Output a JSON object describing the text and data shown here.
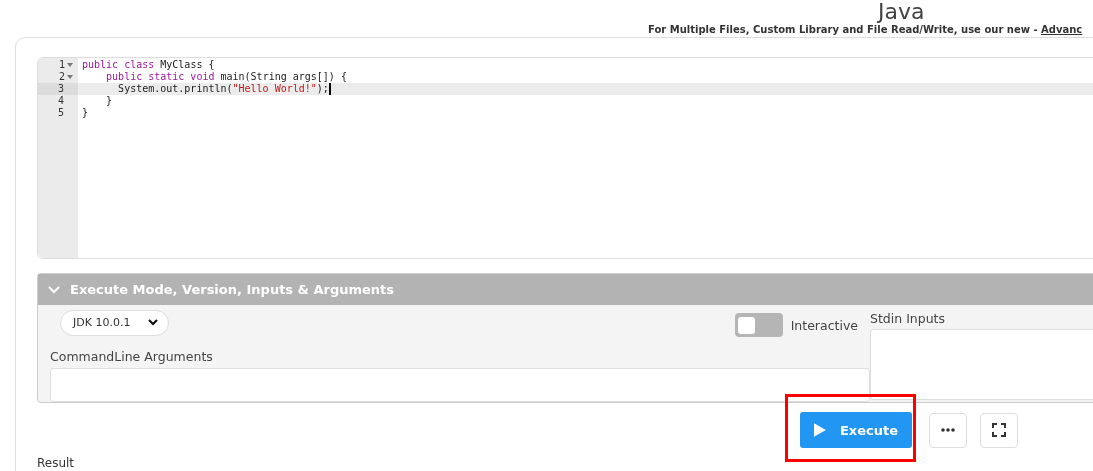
{
  "header": {
    "title": "Java",
    "notice": "For Multiple Files, Custom Library and File Read/Write, use our new - ",
    "notice_link": "Advanc"
  },
  "editor": {
    "lines": [
      {
        "number": "1",
        "foldable": true,
        "active": false,
        "tokens": [
          {
            "kind": "keyword",
            "text": "public class "
          },
          {
            "kind": "plain",
            "text": "MyClass {"
          }
        ]
      },
      {
        "number": "2",
        "foldable": true,
        "active": false,
        "tokens": [
          {
            "kind": "keyword",
            "text": "    public static void "
          },
          {
            "kind": "plain",
            "text": "main(String args[]) {"
          }
        ]
      },
      {
        "number": "3",
        "foldable": false,
        "active": true,
        "tokens": [
          {
            "kind": "plain",
            "text": "      System.out.println("
          },
          {
            "kind": "string",
            "text": "\"Hello World!\""
          },
          {
            "kind": "plain",
            "text": ");"
          }
        ]
      },
      {
        "number": "4",
        "foldable": false,
        "active": false,
        "tokens": [
          {
            "kind": "plain",
            "text": "    }"
          }
        ]
      },
      {
        "number": "5",
        "foldable": false,
        "active": false,
        "tokens": [
          {
            "kind": "plain",
            "text": "}"
          }
        ]
      }
    ]
  },
  "options_panel": {
    "title": "Execute Mode, Version, Inputs & Arguments",
    "expanded": true,
    "version": "JDK 10.0.1",
    "interactive": {
      "label": "Interactive",
      "on": false
    },
    "arguments_label": "CommandLine Arguments",
    "stdin_label": "Stdin Inputs"
  },
  "actions": {
    "execute": "Execute",
    "highlighted": true
  },
  "result_label": "Result"
}
